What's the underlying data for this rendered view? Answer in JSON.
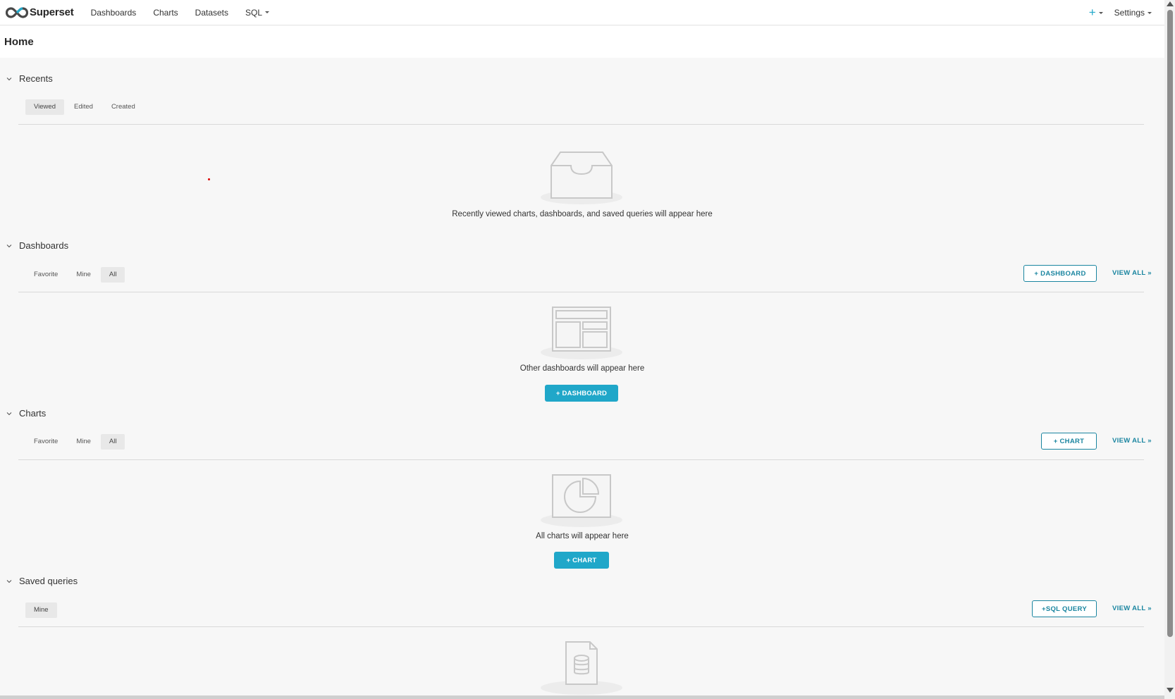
{
  "brand": {
    "name": "Superset",
    "logo_icon": "superset-logo-icon"
  },
  "nav": {
    "links": [
      "Dashboards",
      "Charts",
      "Datasets",
      "SQL"
    ],
    "plus_label": "+",
    "settings_label": "Settings"
  },
  "page": {
    "title": "Home"
  },
  "recents": {
    "title": "Recents",
    "tabs": [
      "Viewed",
      "Edited",
      "Created"
    ],
    "active_tab": "Viewed",
    "empty_text": "Recently viewed charts, dashboards, and saved queries will appear here"
  },
  "dashboards": {
    "title": "Dashboards",
    "tabs": [
      "Favorite",
      "Mine",
      "All"
    ],
    "active_tab": "All",
    "add_button": "+ DASHBOARD",
    "view_all": "VIEW ALL »",
    "empty_text": "Other dashboards will appear here",
    "empty_button": "+ DASHBOARD"
  },
  "charts": {
    "title": "Charts",
    "tabs": [
      "Favorite",
      "Mine",
      "All"
    ],
    "active_tab": "All",
    "add_button": "+ CHART",
    "view_all": "VIEW ALL »",
    "empty_text": "All charts will appear here",
    "empty_button": "+ CHART"
  },
  "saved_queries": {
    "title": "Saved queries",
    "tabs": [
      "Mine"
    ],
    "active_tab": "Mine",
    "add_button": "+SQL QUERY",
    "view_all": "VIEW ALL »"
  },
  "colors": {
    "accent": "#20a7c9",
    "accent_dark": "#1a85a0",
    "background": "#f7f7f7"
  }
}
